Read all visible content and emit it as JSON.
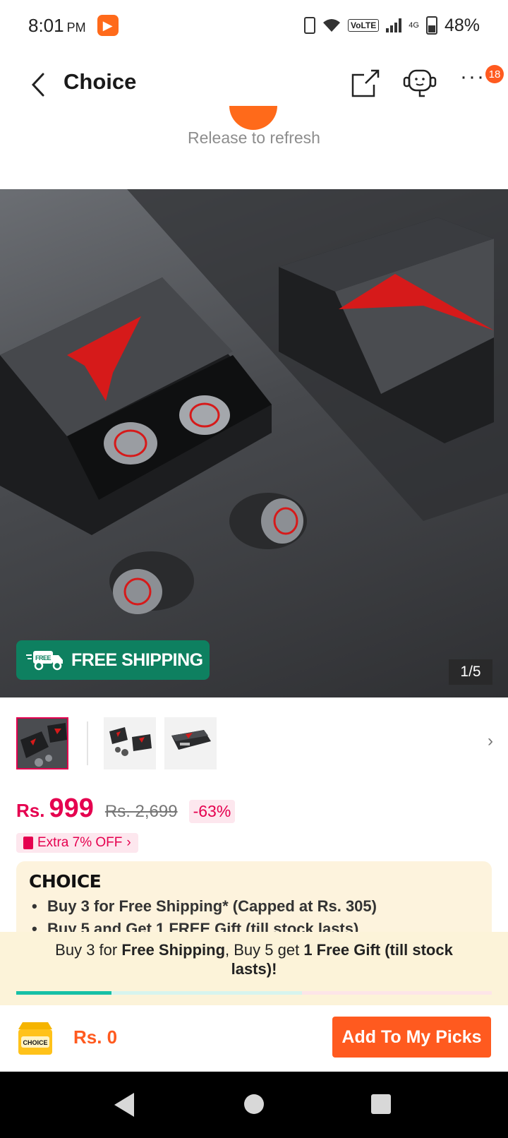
{
  "status_bar": {
    "time": "8:01",
    "ampm": "PM",
    "battery": "48%",
    "network_badge": "VoLTE",
    "network_type": "4G"
  },
  "header": {
    "title": "Choice",
    "notification_count": "18",
    "icons": [
      "back-icon",
      "share-icon",
      "support-icon",
      "more-icon"
    ]
  },
  "refresh": {
    "text": "Release to refresh"
  },
  "gallery": {
    "free_shipping_label": "FREE SHIPPING",
    "free_badge": "FREE",
    "counter": "1/5"
  },
  "price": {
    "currency": "Rs.",
    "current": "999",
    "original": "Rs. 2,699",
    "discount": "-63%",
    "extra_off": "Extra 7% OFF"
  },
  "choice_card": {
    "logo": "CHOICE",
    "bullets": [
      "Buy 3 for  Free Shipping* (Capped at Rs. 305)",
      "Buy 5 and Get 1 FREE Gift (till stock lasts)"
    ]
  },
  "promo_strip": {
    "part1": "Buy 3 for ",
    "bold1": "Free Shipping",
    "part2": ", Buy 5 get ",
    "bold2": "1 Free Gift (till stock lasts)!"
  },
  "bottom_bar": {
    "box_label": "CHOICE",
    "total": "Rs. 0",
    "add_button": "Add To My Picks"
  },
  "colors": {
    "accent": "#ff5a1f",
    "price": "#e5004f",
    "shipping_badge": "#0e8060",
    "choice_card_bg": "#fdf3dd"
  }
}
